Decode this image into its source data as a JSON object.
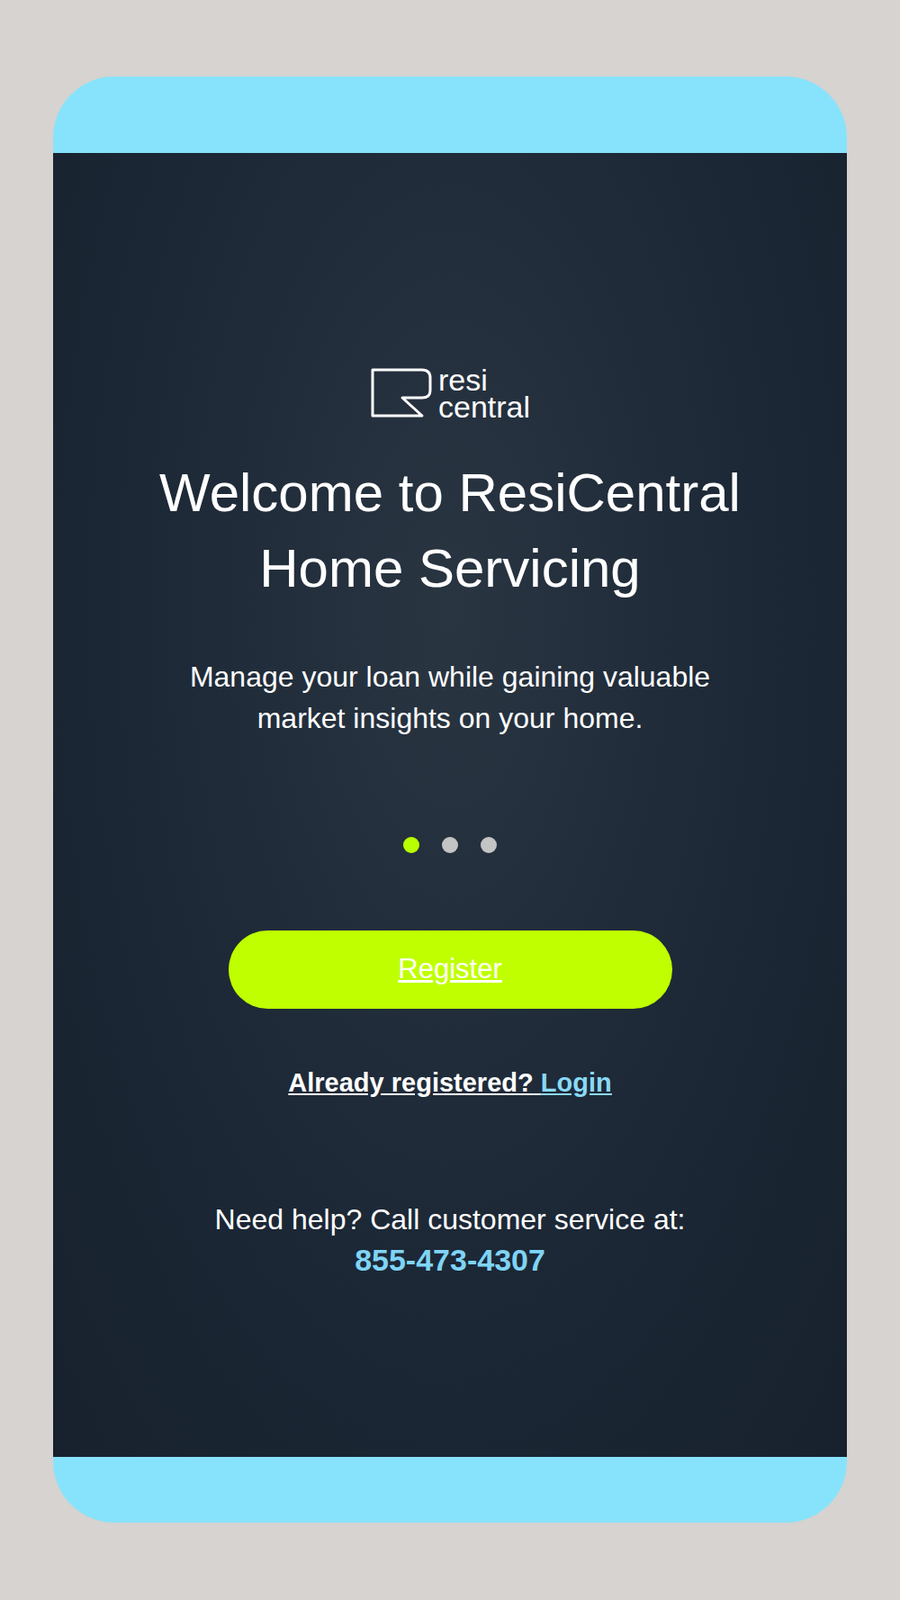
{
  "logo": {
    "lines": [
      "resi",
      "central"
    ]
  },
  "title": [
    "Welcome to ResiCentral",
    "Home Servicing"
  ],
  "subtitle": [
    "Manage your loan while gaining valuable",
    "market insights on your home."
  ],
  "carousel": {
    "dots": [
      {
        "selected": true
      },
      {
        "selected": false
      },
      {
        "selected": false
      }
    ]
  },
  "register_button": "Register",
  "login_prompt": {
    "text": "Already registered?",
    "link": "Login"
  },
  "help": {
    "text": "Need help? Call customer service at:",
    "phone": "855-473-4307"
  }
}
